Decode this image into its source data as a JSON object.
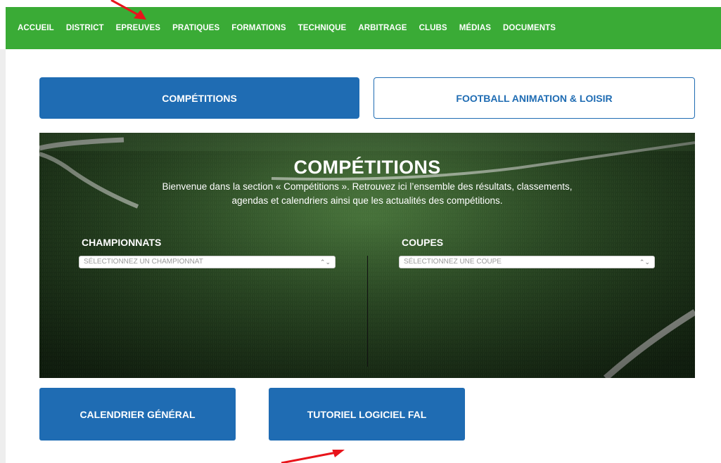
{
  "nav": {
    "items": [
      "ACCUEIL",
      "DISTRICT",
      "EPREUVES",
      "PRATIQUES",
      "FORMATIONS",
      "TECHNIQUE",
      "ARBITRAGE",
      "CLUBS",
      "MÉDIAS",
      "DOCUMENTS"
    ]
  },
  "tabs": {
    "active": "COMPÉTITIONS",
    "inactive": "FOOTBALL ANIMATION & LOISIR"
  },
  "hero": {
    "title": "COMPÉTITIONS",
    "line1": "Bienvenue dans la section « Compétitions ». Retrouvez ici l’ensemble des résultats, classements,",
    "line2": "agendas et calendriers ainsi que les actualités des compétitions.",
    "championnats": {
      "label": "CHAMPIONNATS",
      "placeholder": "SÉLECTIONNEZ UN CHAMPIONNAT"
    },
    "coupes": {
      "label": "COUPES",
      "placeholder": "SÉLECTIONNEZ UNE COUPE"
    }
  },
  "buttons": {
    "calendar": "CALENDRIER GÉNÉRAL",
    "tutorial": "TUTORIEL LOGICIEL FAL"
  },
  "colors": {
    "nav_green": "#3aab36",
    "brand_blue": "#1f6cb3",
    "annotation_red": "#e8141b"
  },
  "icons": {
    "select_chevron": "chevron-up-down-icon",
    "annotation": "red-arrow-icon"
  }
}
